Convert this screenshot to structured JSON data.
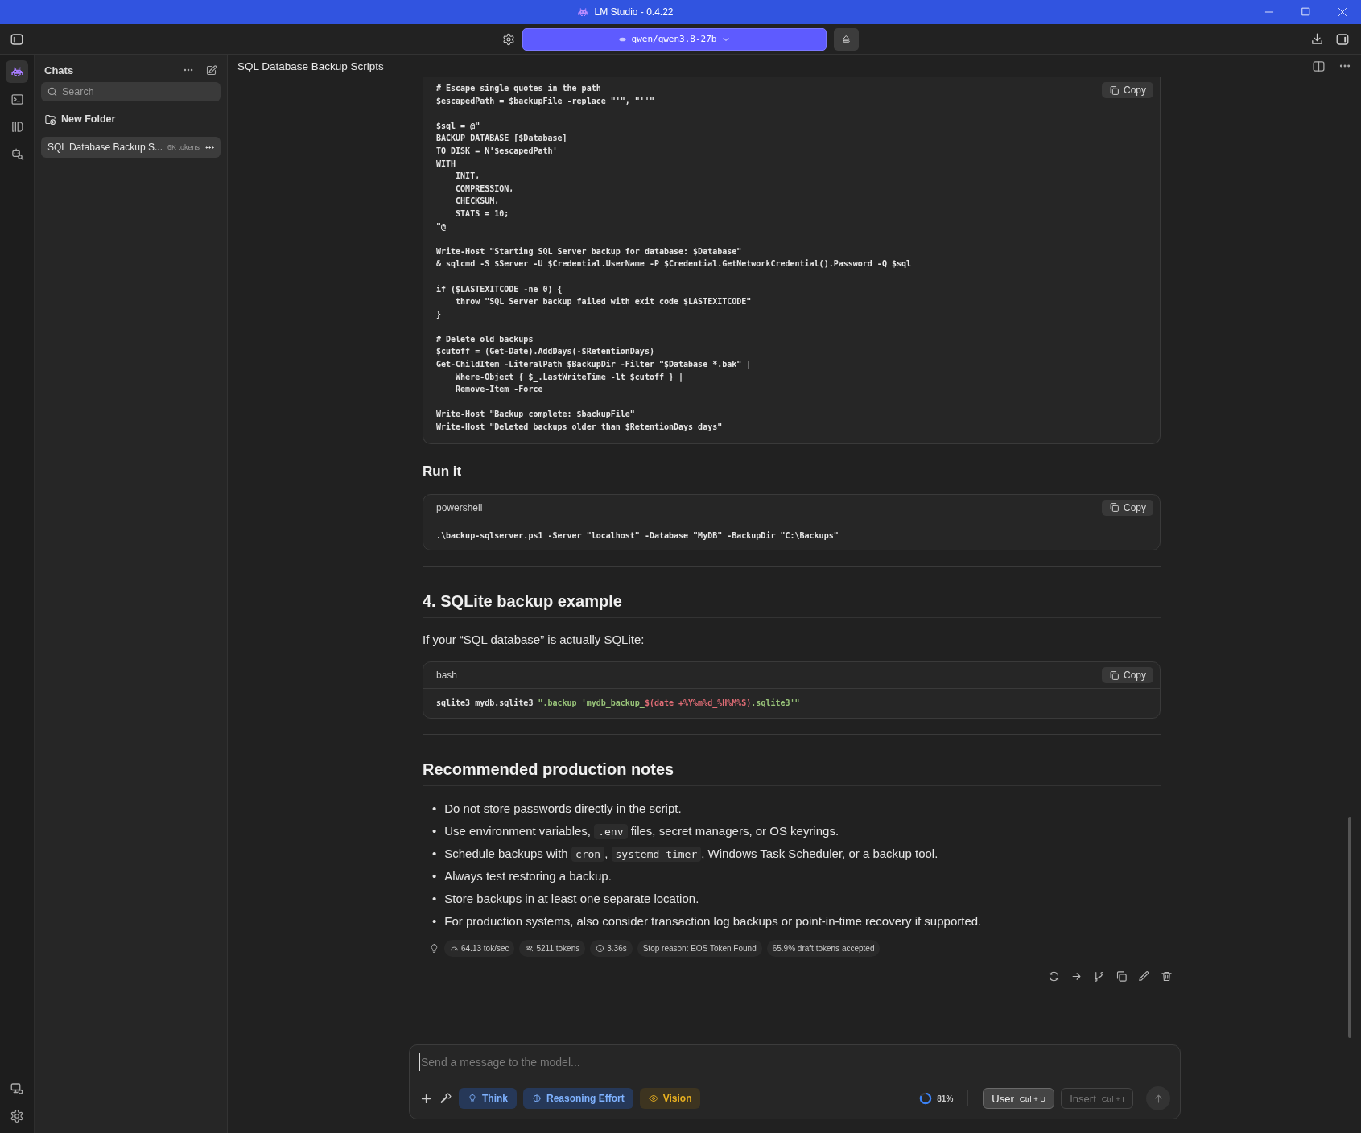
{
  "window": {
    "title": "LM Studio - 0.4.22"
  },
  "toolbar": {
    "model": "qwen/qwen3.8-27b"
  },
  "rail": {
    "items": [
      {
        "kind": "chat",
        "selected": true
      },
      {
        "kind": "terminal",
        "selected": false
      },
      {
        "kind": "models",
        "selected": false
      },
      {
        "kind": "discover",
        "selected": false
      }
    ]
  },
  "sidebar": {
    "title": "Chats",
    "search": {
      "placeholder": "Search"
    },
    "new_folder": "New Folder",
    "chats": [
      {
        "title": "SQL Database Backup S...",
        "tokens": "6K tokens",
        "selected": true
      }
    ]
  },
  "chat": {
    "title": "SQL Database Backup Scripts",
    "blocks": [
      {
        "kind": "code",
        "copy": "Copy",
        "groups": [
          [
            "# Escape single quotes in the path",
            "$escapedPath = $backupFile -replace \"'\", \"''\""
          ],
          [
            "$sql = @\"",
            "BACKUP DATABASE [$Database]",
            "TO DISK = N'$escapedPath'",
            "WITH",
            "    INIT,",
            "    COMPRESSION,",
            "    CHECKSUM,",
            "    STATS = 10;",
            "\"@"
          ],
          [
            "Write-Host \"Starting SQL Server backup for database: $Database\"",
            "& sqlcmd -S $Server -U $Credential.UserName -P $Credential.GetNetworkCredential().Password -Q $sql"
          ],
          [
            "if ($LASTEXITCODE -ne 0) {",
            "    throw \"SQL Server backup failed with exit code $LASTEXITCODE\"",
            "}"
          ],
          [
            "# Delete old backups",
            "$cutoff = (Get-Date).AddDays(-$RetentionDays)",
            "Get-ChildItem -LiteralPath $BackupDir -Filter \"$Database_*.bak\" |",
            "    Where-Object { $_.LastWriteTime -lt $cutoff } |",
            "    Remove-Item -Force"
          ],
          [
            "Write-Host \"Backup complete: $backupFile\"",
            "Write-Host \"Deleted backups older than $RetentionDays days\""
          ]
        ]
      },
      {
        "kind": "subheading",
        "text": "Run it"
      },
      {
        "kind": "code",
        "language": "powershell",
        "copy": "Copy",
        "groups": [
          [
            ".\\backup-sqlserver.ps1 -Server \"localhost\" -Database \"MyDB\" -BackupDir \"C:\\Backups\""
          ]
        ]
      },
      {
        "kind": "divider"
      },
      {
        "kind": "heading",
        "text": "4. SQLite backup example"
      },
      {
        "kind": "paragraph",
        "text": "If your “SQL database” is actually SQLite:"
      },
      {
        "kind": "code",
        "language": "bash",
        "copy": "Copy",
        "groups": [
          [
            {
              "tokens": [
                {
                  "text": "sqlite3 mydb.sqlite3 "
                },
                {
                  "text": "\".backup 'mydb_backup_",
                  "color": "#98c379"
                },
                {
                  "text": "$(date +%Y%m%d_%H%M%S)",
                  "color": "#e06c75"
                },
                {
                  "text": ".sqlite3'\"",
                  "color": "#98c379"
                }
              ]
            }
          ]
        ]
      },
      {
        "kind": "divider"
      },
      {
        "kind": "heading",
        "text": "Recommended production notes"
      },
      {
        "kind": "list",
        "items": [
          {
            "marker": "•",
            "parts": [
              {
                "text": "Do not store passwords directly in the script."
              }
            ]
          },
          {
            "marker": "•",
            "parts": [
              {
                "text": "Use environment variables, "
              },
              {
                "code": ".env"
              },
              {
                "text": " files, secret managers, or OS keyrings."
              }
            ]
          },
          {
            "marker": "•",
            "parts": [
              {
                "text": "Schedule backups with "
              },
              {
                "code": "cron"
              },
              {
                "text": ", "
              },
              {
                "code": "systemd timer"
              },
              {
                "text": ", Windows Task Scheduler, or a backup tool."
              }
            ]
          },
          {
            "marker": "•",
            "parts": [
              {
                "text": "Always test restoring a backup."
              }
            ]
          },
          {
            "marker": "•",
            "parts": [
              {
                "text": "Store backups in at least one separate location."
              }
            ]
          },
          {
            "marker": "•",
            "parts": [
              {
                "text": "For production systems, also consider transaction log backups or point-in-time recovery if supported."
              }
            ]
          }
        ]
      }
    ],
    "stats": [
      {
        "kind": "speed",
        "text": "64.13 tok/sec"
      },
      {
        "kind": "tokens",
        "text": "5211 tokens"
      },
      {
        "kind": "time",
        "text": "3.36s"
      },
      {
        "kind": "plain",
        "text": "Stop reason: EOS Token Found"
      },
      {
        "kind": "plain",
        "text": "65.9% draft tokens accepted"
      }
    ]
  },
  "composer": {
    "placeholder": "Send a message to the model...",
    "toggles": [
      {
        "kind": "think",
        "label": "Think"
      },
      {
        "kind": "effort",
        "label": "Reasoning Effort"
      },
      {
        "kind": "vision",
        "label": "Vision"
      }
    ],
    "context": {
      "reading": "81%"
    },
    "buttons": [
      {
        "label": "User",
        "shortcut": "Ctrl + U",
        "disabled": false
      },
      {
        "label": "Insert",
        "shortcut": "Ctrl + I",
        "disabled": true
      }
    ]
  }
}
